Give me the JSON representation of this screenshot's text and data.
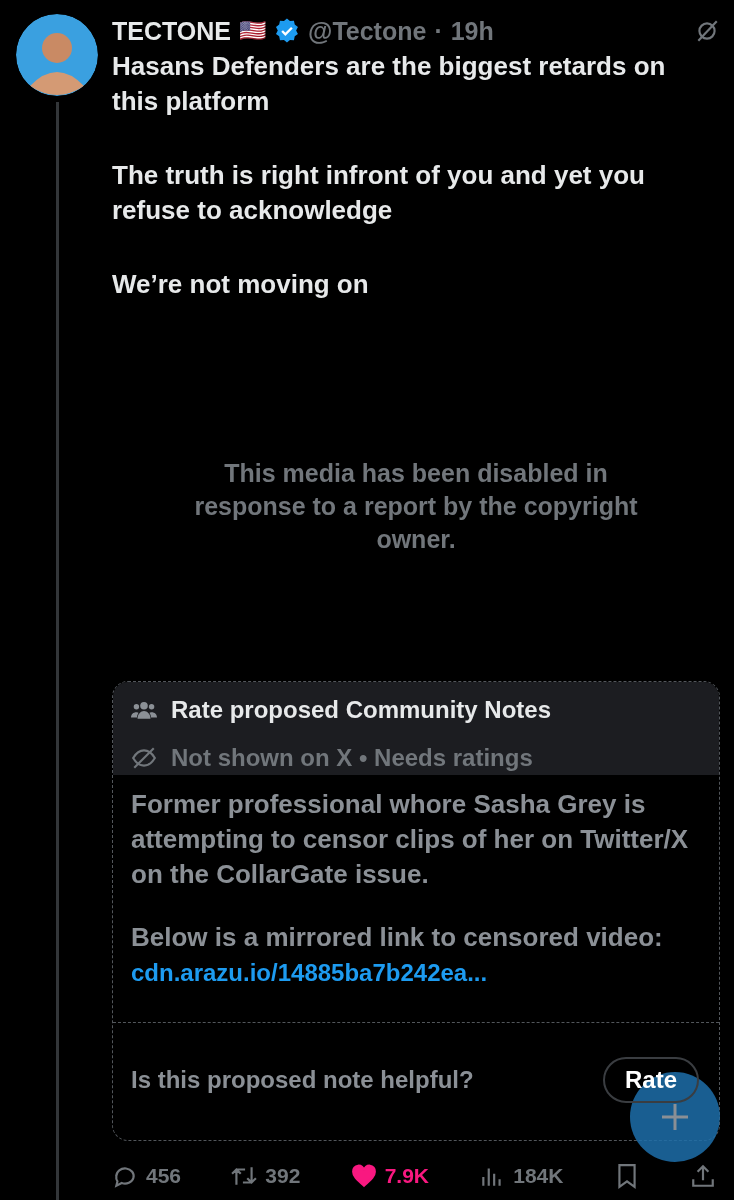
{
  "post": {
    "name": "TECTONE",
    "flag": "🇺🇸",
    "verified": true,
    "handle": "@Tectone",
    "separator": "·",
    "time": "19h",
    "paragraphs": [
      "Hasans Defenders are the biggest retards on this platform",
      "The truth is right infront of you and yet you refuse to acknowledge",
      "We’re not moving on"
    ],
    "media_notice": "This media has been disabled in response to a report by the copyright owner."
  },
  "note": {
    "title": "Rate proposed Community Notes",
    "status": "Not shown on X • Needs ratings",
    "paragraphs": [
      "Former professional whore Sasha Grey is attempting to censor clips of her on Twitter/X on the CollarGate issue.",
      "Below is a mirrored link to censored video:"
    ],
    "link": "cdn.arazu.io/14885ba7b242ea...",
    "question": "Is this proposed note helpful?",
    "rate_button": "Rate"
  },
  "actions": {
    "replies": "456",
    "reposts": "392",
    "likes": "7.9K",
    "liked": true,
    "views": "184K"
  }
}
